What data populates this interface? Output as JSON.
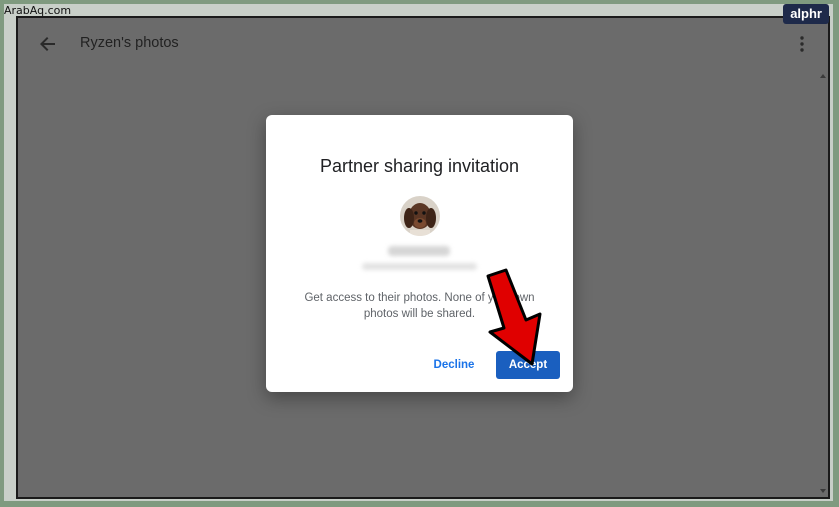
{
  "watermark": "ArabAq.com",
  "brand": "alphr",
  "topbar": {
    "title": "Ryzen's photos",
    "back_icon": "arrow-left-icon",
    "more_icon": "more-vert-icon"
  },
  "dialog": {
    "title": "Partner sharing invitation",
    "body": "Get access to their photos. None of your own photos will be shared.",
    "decline_label": "Decline",
    "accept_label": "Accept"
  },
  "colors": {
    "primary": "#1a73e8",
    "accept_bg": "#1a5fbf",
    "overlay": "#6b6b6b",
    "annotation_arrow": "#e00000"
  }
}
